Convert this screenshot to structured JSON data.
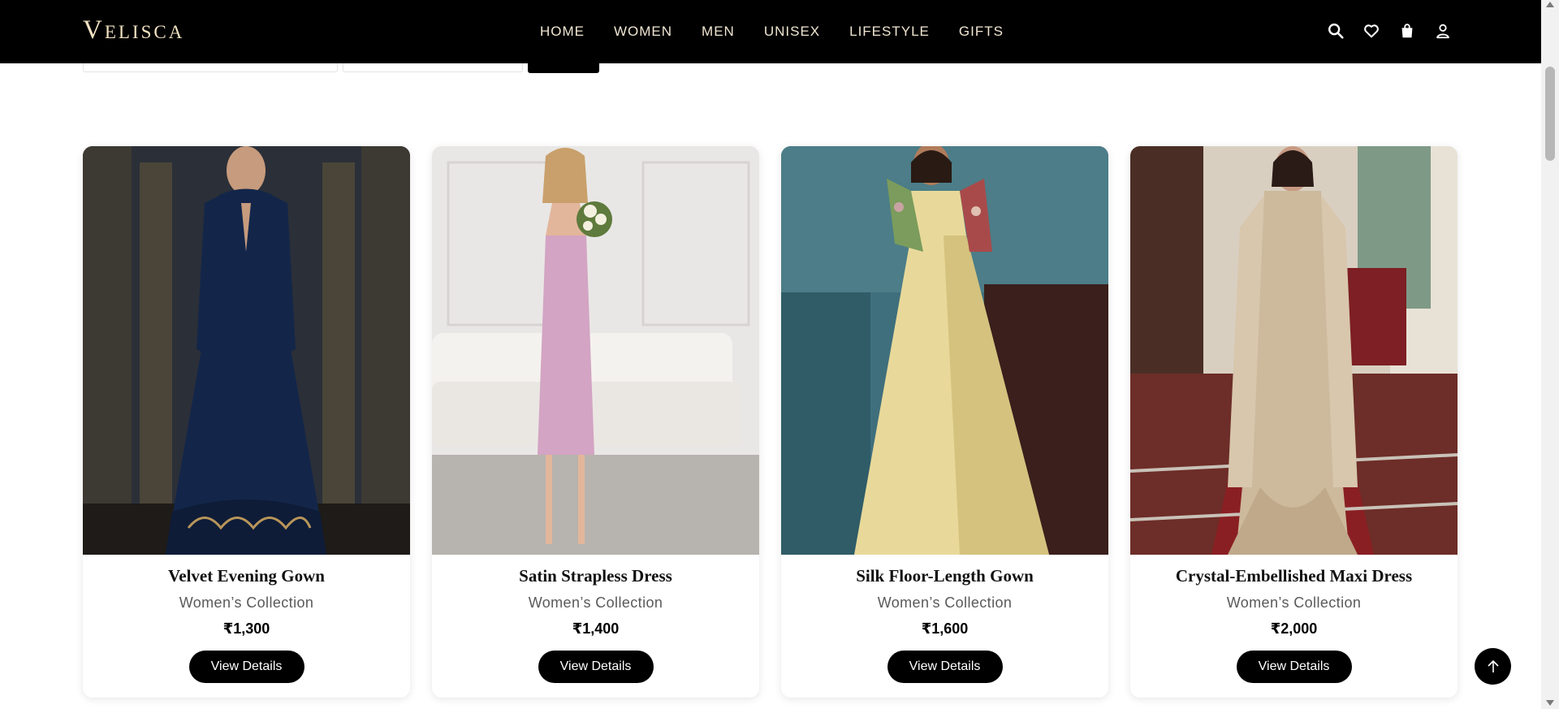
{
  "brand": {
    "logo_text": "Velisca"
  },
  "nav": {
    "items": [
      {
        "label": "HOME"
      },
      {
        "label": "WOMEN"
      },
      {
        "label": "MEN"
      },
      {
        "label": "UNISEX"
      },
      {
        "label": "LIFESTYLE"
      },
      {
        "label": "GIFTS"
      }
    ]
  },
  "header_icons": [
    "search-icon",
    "heart-icon",
    "shopping-bag-icon",
    "user-icon"
  ],
  "products": [
    {
      "name": "Velvet Evening Gown",
      "collection": "Women’s Collection",
      "price": "₹1,300",
      "button": "View Details",
      "dress_color": "#13264a"
    },
    {
      "name": "Satin Strapless Dress",
      "collection": "Women’s Collection",
      "price": "₹1,400",
      "button": "View Details",
      "dress_color": "#d3a4c3"
    },
    {
      "name": "Silk Floor-Length Gown",
      "collection": "Women’s Collection",
      "price": "₹1,600",
      "button": "View Details",
      "dress_color": "#e8d99a"
    },
    {
      "name": "Crystal-Embellished Maxi Dress",
      "collection": "Women’s Collection",
      "price": "₹2,000",
      "button": "View Details",
      "dress_color": "#cdb99c"
    }
  ],
  "colors": {
    "header_bg": "#000000",
    "nav_text": "#f0e6d2",
    "accent": "#000000"
  }
}
